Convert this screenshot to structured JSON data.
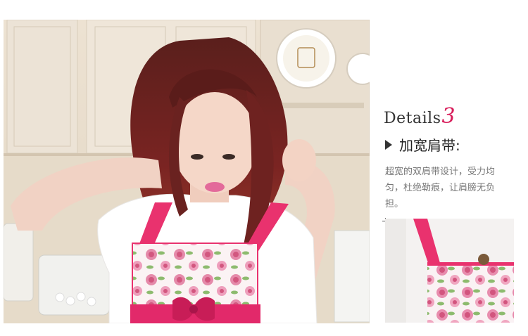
{
  "details": {
    "word": "Details",
    "number": "3"
  },
  "feature": {
    "title": "加宽肩带:",
    "description": "超宽的双肩带设计，受力均匀，杜绝勒痕，让肩膀无负担。"
  },
  "colors": {
    "accent": "#d81e5b",
    "strap_pink": "#e9326e",
    "text_dark": "#333333",
    "text_gray": "#777777"
  },
  "images": {
    "main": "woman wearing pink floral apron in kitchen",
    "detail": "close-up of widened apron shoulder strap"
  },
  "icons": {
    "bullet": "play-arrow-icon"
  }
}
